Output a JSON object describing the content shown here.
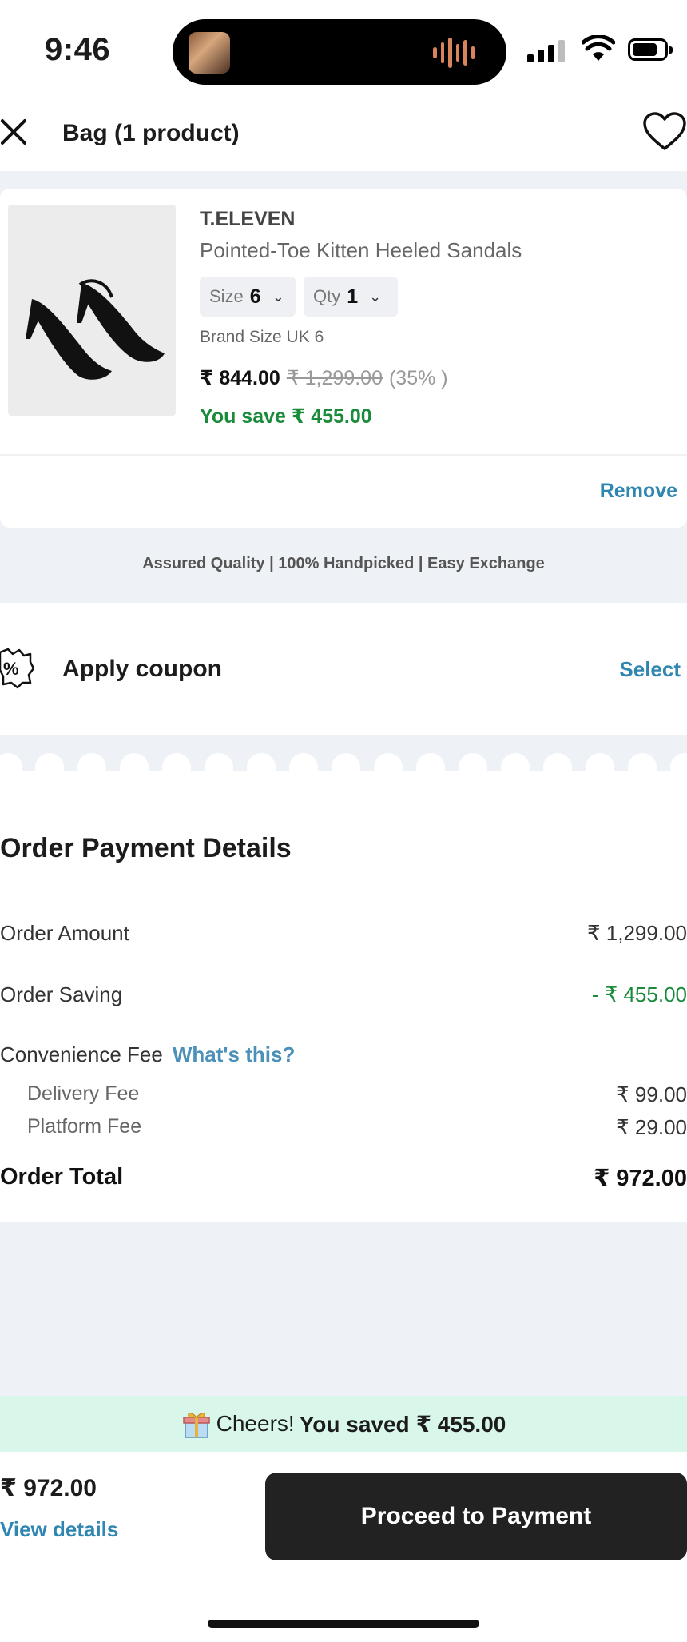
{
  "status_bar": {
    "time": "9:46"
  },
  "header": {
    "title": "Bag (1 product)"
  },
  "product": {
    "brand": "T.ELEVEN",
    "name": "Pointed-Toe Kitten Heeled Sandals",
    "size_label": "Size",
    "size_value": "6",
    "qty_label": "Qty",
    "qty_value": "1",
    "brand_size": "Brand Size UK 6",
    "price": "₹ 844.00",
    "mrp": "₹ 1,299.00",
    "discount": "(35% )",
    "you_save": "You save ₹ 455.00",
    "remove_label": "Remove"
  },
  "assurance_text": "Assured Quality | 100% Handpicked | Easy Exchange",
  "coupon": {
    "label": "Apply coupon",
    "action": "Select"
  },
  "payment": {
    "title": "Order Payment Details",
    "order_amount_label": "Order Amount",
    "order_amount_value": "₹ 1,299.00",
    "order_saving_label": "Order Saving",
    "order_saving_value": "- ₹ 455.00",
    "convenience_label": "Convenience Fee",
    "whats_this": "What's this?",
    "delivery_label": "Delivery Fee",
    "delivery_value": "₹ 99.00",
    "platform_label": "Platform Fee",
    "platform_value": "₹ 29.00",
    "total_label": "Order Total",
    "total_value": "₹ 972.00"
  },
  "savings_banner": {
    "prefix": "Cheers!",
    "text": "You saved ₹ 455.00"
  },
  "footer": {
    "total": "₹ 972.00",
    "view_details": "View details",
    "proceed": "Proceed to Payment"
  },
  "colors": {
    "accent_link": "#2f86b0",
    "savings_green": "#1a8b3a",
    "banner_bg": "#d8f7ea",
    "cta_bg": "#222222",
    "section_bg": "#eef1f5"
  },
  "icons": [
    "close-icon",
    "heart-icon",
    "coupon-percent-icon",
    "gift-icon",
    "chevron-down-icon",
    "wifi-icon",
    "battery-icon",
    "signal-icon"
  ]
}
